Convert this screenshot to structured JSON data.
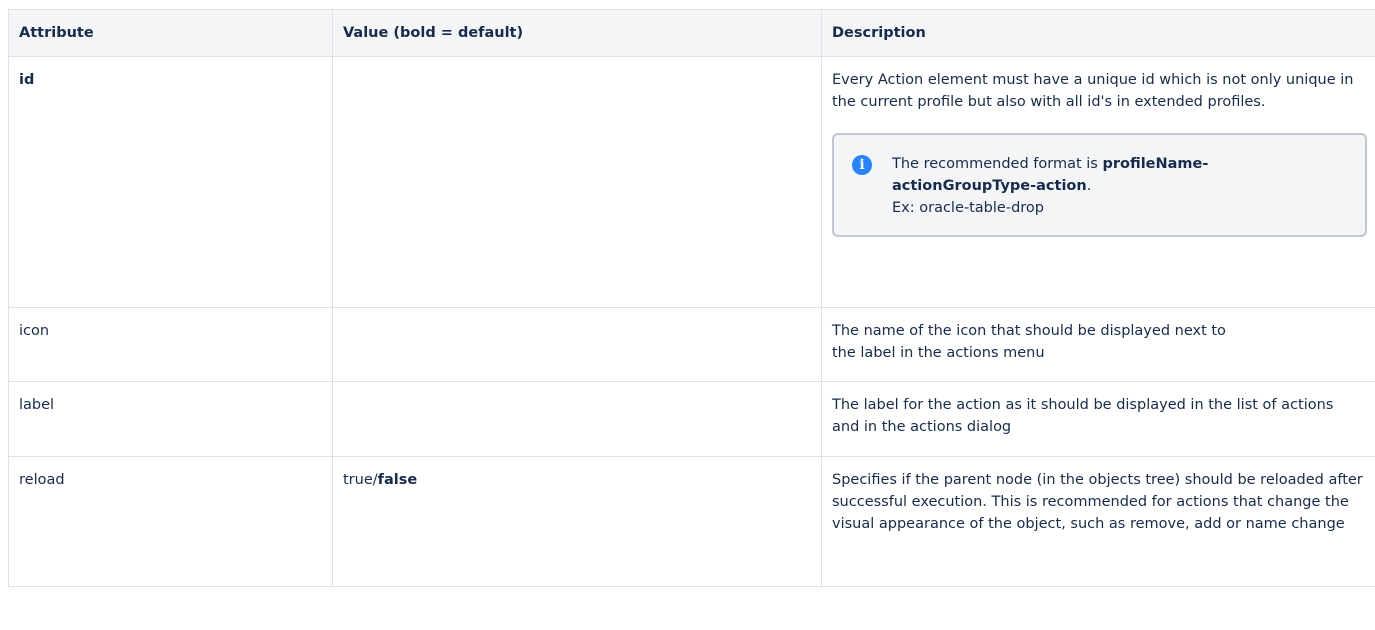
{
  "table": {
    "headers": {
      "attribute": "Attribute",
      "value": "Value (bold = default)",
      "description": "Description"
    },
    "rows": {
      "id": {
        "attribute": "id",
        "value": "",
        "description": "Every Action element must have a unique id which is not only unique in the current profile but also with all id's in extended profiles.",
        "info": {
          "icon": "info-icon",
          "intro": "The recommended format is ",
          "format": "profileName-actionGroupType-action",
          "period": ".",
          "example": "Ex: oracle-table-drop"
        }
      },
      "icon": {
        "attribute": "icon",
        "value": "",
        "description_line1": "The name of the icon that should be displayed next to",
        "description_line2": "the label in the actions menu"
      },
      "label": {
        "attribute": "label",
        "value": "",
        "description": "The label for the action as it should be displayed in the list of actions and in the actions dialog"
      },
      "reload": {
        "attribute": "reload",
        "value_prefix": "true/",
        "value_default": "false",
        "description": "Specifies if the parent node (in the objects tree) should be reloaded after successful execution. This is recommended for actions that change the visual appearance of the object, such as remove, add or name change"
      }
    }
  }
}
